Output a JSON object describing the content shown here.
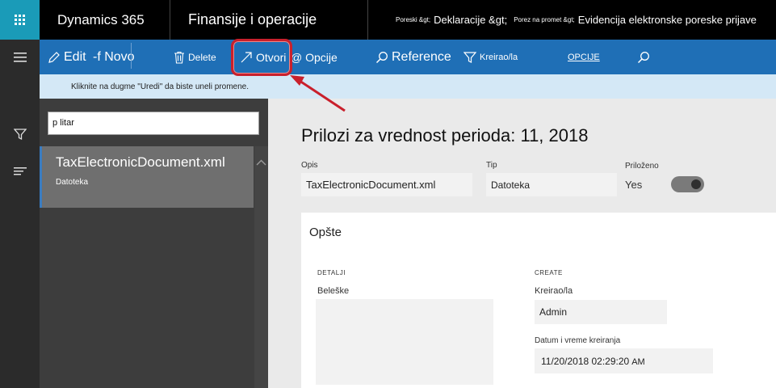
{
  "topbar": {
    "brand": "Dynamics 365",
    "module": "Finansije i operacije",
    "breadcrumbs": [
      {
        "text": "Poreski &gt;",
        "small": true
      },
      {
        "text": "Deklaracije &gt;",
        "small": false
      },
      {
        "text": "Porez na promet &gt;",
        "small": true
      },
      {
        "text": "Evidencija elektronske poreske prijave",
        "small": false
      }
    ]
  },
  "actions": {
    "edit": "Edit",
    "new": "-f Novo",
    "delete": "Delete",
    "open": "Otvori",
    "options": "@ Opcije",
    "reference": "Reference",
    "created_by": "Kreirao/la",
    "options_caps": "OPCIJE"
  },
  "info_bar": {
    "message": "Kliknite na dugme \"Uredi\" da biste uneli promene."
  },
  "nav_icons": [
    "menu-icon",
    "filter-icon",
    "list-icon"
  ],
  "list": {
    "filter_value": "p litar",
    "items": [
      {
        "title": "TaxElectronicDocument.xml",
        "subtitle": "Datoteka"
      }
    ]
  },
  "detail": {
    "title": "Prilozi za vrednost perioda: 11, 2018",
    "fields": {
      "description_label": "Opis",
      "description_value": "TaxElectronicDocument.xml",
      "type_label": "Tip",
      "type_value": "Datoteka",
      "attached_label": "Priloženo",
      "attached_value": "Yes"
    },
    "general": {
      "title": "Opšte",
      "details_section": "DETALJI",
      "notes_label": "Beleške",
      "create_section": "CREATE",
      "created_by_label": "Kreirao/la",
      "created_by_value": "Admin",
      "created_at_label": "Datum i vreme kreiranja",
      "created_at_value": "11/20/2018 02:29:20",
      "created_at_ampm": "AM"
    }
  },
  "colors": {
    "waffle": "#1a9bb8",
    "action_bar": "#1f6fb6",
    "info_bar": "#d4e8f6",
    "highlight": "#c9202c"
  }
}
